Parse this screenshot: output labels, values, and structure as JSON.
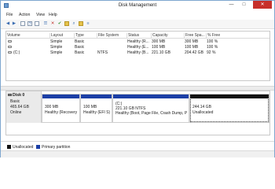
{
  "window": {
    "title": "Disk Management",
    "minimize": "—",
    "maximize": "□",
    "close": "✕"
  },
  "menu": [
    "File",
    "Action",
    "View",
    "Help"
  ],
  "toolbar": [
    {
      "icon": "back-arrow-icon",
      "glyph": "◀"
    },
    {
      "icon": "forward-arrow-icon",
      "glyph": "▶"
    },
    {
      "icon": "properties-icon",
      "glyph": ""
    },
    {
      "icon": "help-icon",
      "glyph": "?"
    },
    {
      "icon": "list-view-icon",
      "glyph": ""
    },
    {
      "icon": "connect-icon",
      "glyph": "☰"
    },
    {
      "icon": "delete-icon",
      "glyph": "✕"
    },
    {
      "icon": "checkmark-icon",
      "glyph": "✔"
    },
    {
      "icon": "folder-open-icon",
      "glyph": ""
    },
    {
      "icon": "search-icon",
      "glyph": "⌕"
    },
    {
      "icon": "folder-icon",
      "glyph": ""
    },
    {
      "icon": "settings-icon",
      "glyph": "≡"
    }
  ],
  "volumes": {
    "columns": [
      "Volume",
      "Layout",
      "Type",
      "File System",
      "Status",
      "Capacity",
      "Free Spa...",
      "% Free"
    ],
    "rows": [
      [
        "",
        "Simple",
        "Basic",
        "",
        "Healthy (R...",
        "300 MB",
        "300 MB",
        "100 %"
      ],
      [
        "",
        "Simple",
        "Basic",
        "",
        "Healthy (E...",
        "100 MB",
        "100 MB",
        "100 %"
      ],
      [
        "(C:)",
        "Simple",
        "Basic",
        "NTFS",
        "Healthy (B...",
        "221.10 GB",
        "204.42 GB",
        "92 %"
      ]
    ]
  },
  "disk": {
    "name": "Disk 0",
    "type": "Basic",
    "size": "465.64 GB",
    "status": "Online",
    "partitions": [
      {
        "title": "",
        "size": "300 MB",
        "status": "Healthy (Recovery",
        "kind": "primary"
      },
      {
        "title": "",
        "size": "100 MB",
        "status": "Healthy (EFI S)",
        "kind": "primary"
      },
      {
        "title": "(C:)",
        "size": "221.10 GB NTFS",
        "status": "Healthy (Boot, Page File, Crash Dump, Prim",
        "kind": "primary"
      },
      {
        "title": "",
        "size": "244.14 GB",
        "status": "Unallocated",
        "kind": "unallocated"
      }
    ]
  },
  "legend": [
    {
      "label": "Unallocated",
      "color": "#111111"
    },
    {
      "label": "Primary partition",
      "color": "#1b3fa6"
    }
  ]
}
